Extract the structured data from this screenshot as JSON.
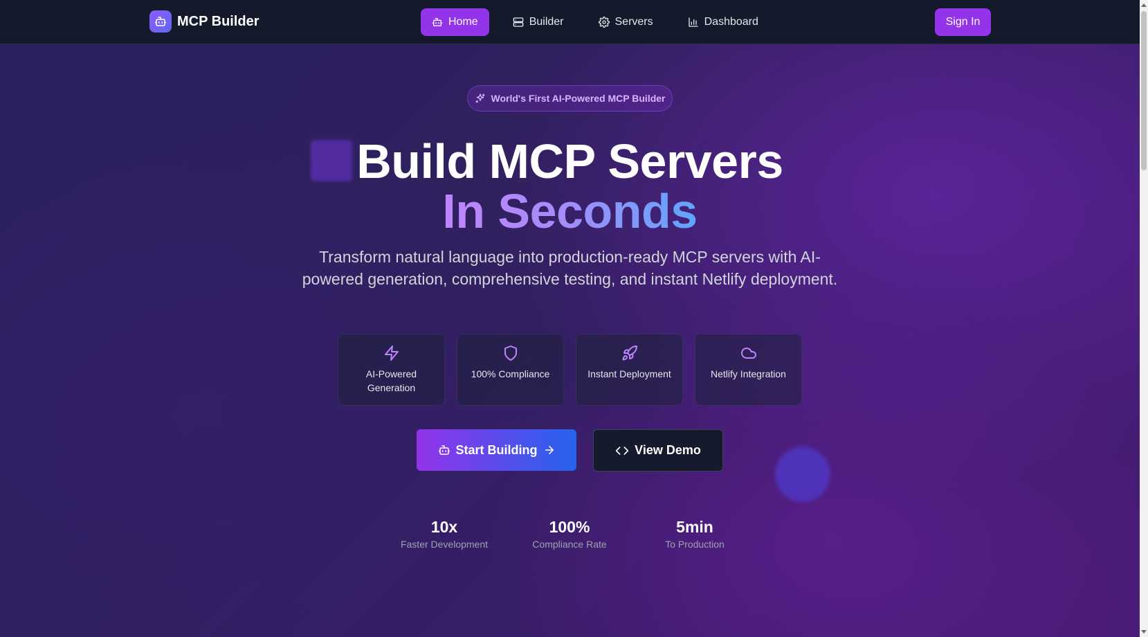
{
  "nav": {
    "brand": "MCP Builder",
    "links": [
      {
        "label": "Home",
        "icon": "bot-icon"
      },
      {
        "label": "Builder",
        "icon": "server-icon"
      },
      {
        "label": "Servers",
        "icon": "gear-icon"
      },
      {
        "label": "Dashboard",
        "icon": "bar-chart-icon"
      }
    ],
    "signin": "Sign In"
  },
  "hero": {
    "badge": "World's First AI-Powered MCP Builder",
    "title_line1": "Build MCP Servers",
    "title_line2": "In Seconds",
    "subtitle": "Transform natural language into production-ready MCP servers with AI-powered generation, comprehensive testing, and instant Netlify deployment.",
    "features": [
      {
        "label": "AI-Powered Generation",
        "icon": "lightning-icon"
      },
      {
        "label": "100% Compliance",
        "icon": "shield-icon"
      },
      {
        "label": "Instant Deployment",
        "icon": "rocket-icon"
      },
      {
        "label": "Netlify Integration",
        "icon": "cloud-icon"
      }
    ],
    "cta_primary": "Start Building",
    "cta_secondary": "View Demo",
    "stats": [
      {
        "value": "10x",
        "label": "Faster Development"
      },
      {
        "value": "100%",
        "label": "Compliance Rate"
      },
      {
        "value": "5min",
        "label": "To Production"
      }
    ]
  },
  "colors": {
    "accent": "#9333ea",
    "nav_bg": "#141a2b",
    "gradient_start": "#9333ea",
    "gradient_end": "#2563eb"
  }
}
